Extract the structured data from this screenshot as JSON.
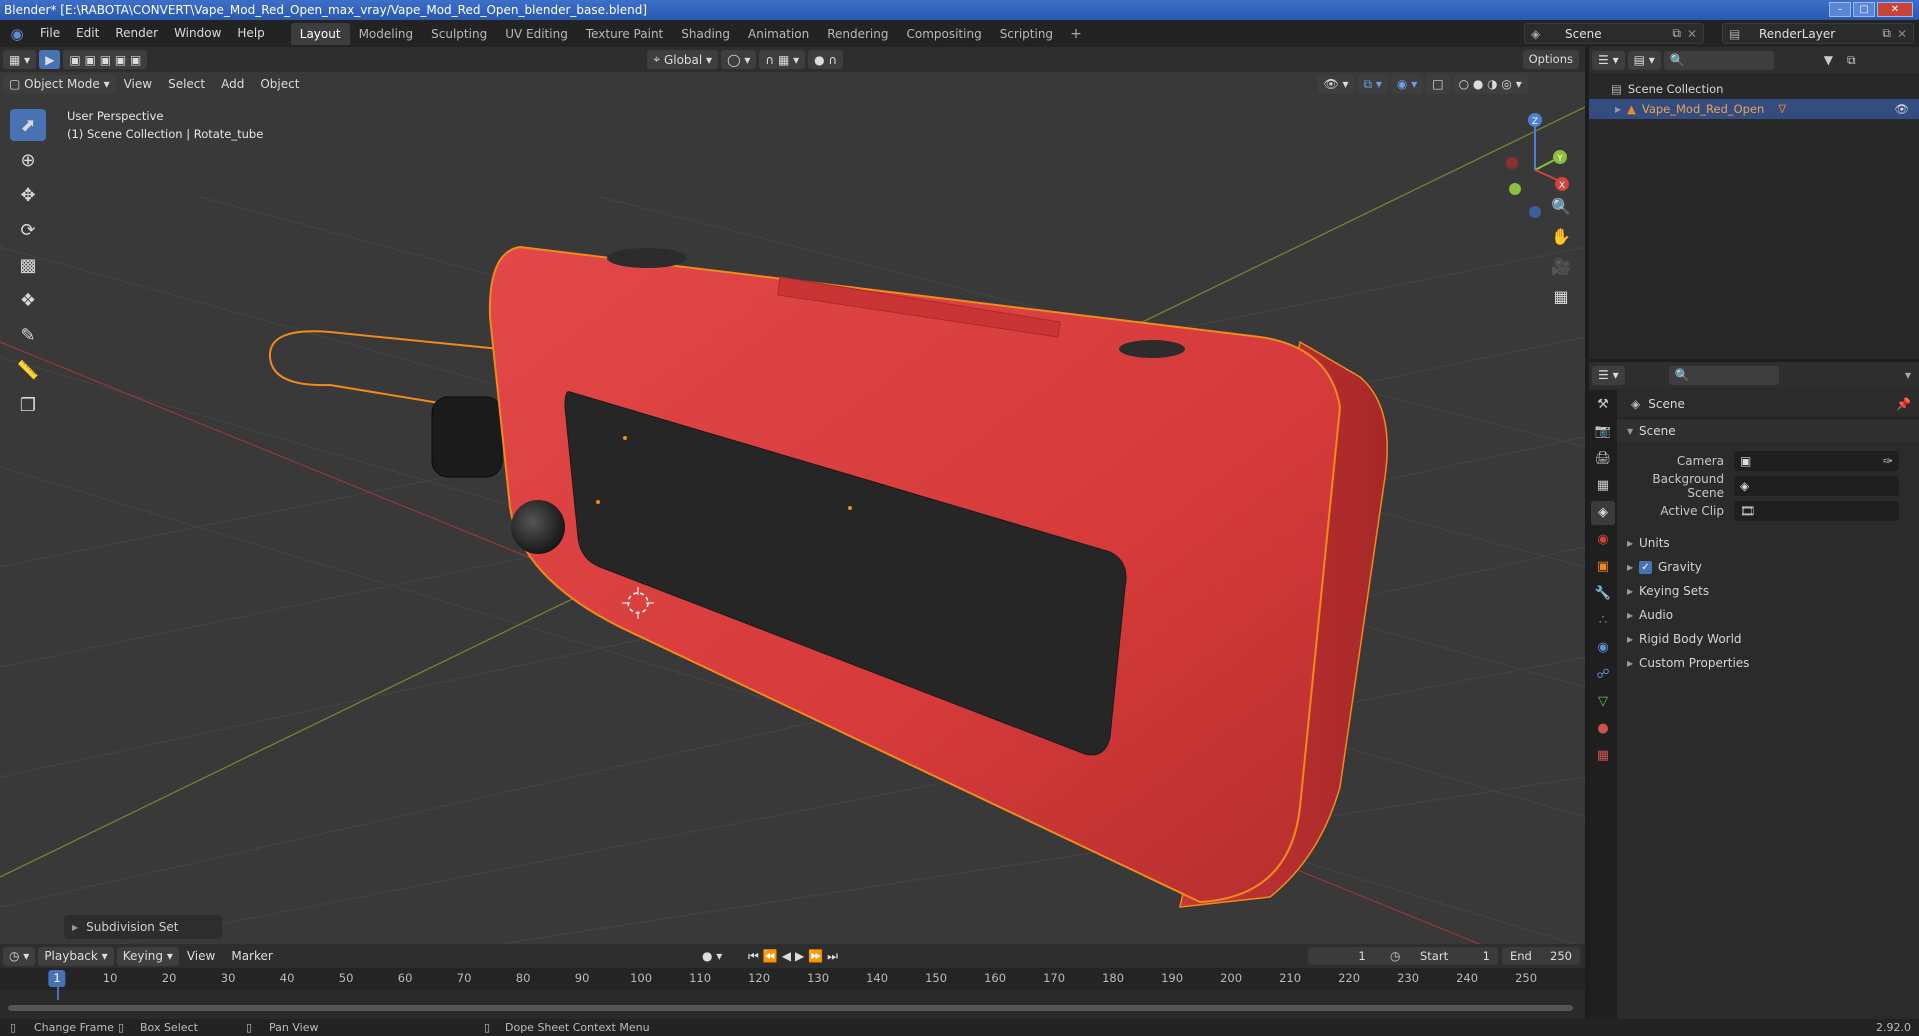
{
  "window": {
    "title": "Blender* [E:\\RABOTA\\CONVERT\\Vape_Mod_Red_Open_max_vray/Vape_Mod_Red_Open_blender_base.blend]"
  },
  "menu": [
    "File",
    "Edit",
    "Render",
    "Window",
    "Help"
  ],
  "workspaces": [
    "Layout",
    "Modeling",
    "Sculpting",
    "UV Editing",
    "Texture Paint",
    "Shading",
    "Animation",
    "Rendering",
    "Compositing",
    "Scripting"
  ],
  "scene_name": "Scene",
  "render_layer": "RenderLayer",
  "viewport": {
    "transform_orientation": "Global",
    "options_label": "Options",
    "mode": "Object Mode",
    "menus": [
      "View",
      "Select",
      "Add",
      "Object"
    ],
    "perspective": "User Perspective",
    "collection_info": "(1) Scene Collection | Rotate_tube",
    "last_operator": "Subdivision Set",
    "gizmo": {
      "x_label": "X",
      "y_label": "Y",
      "z_label": "Z"
    }
  },
  "outliner": {
    "root": "Scene Collection",
    "object": "Vape_Mod_Red_Open"
  },
  "properties": {
    "context": "Scene",
    "section": "Scene",
    "fields": [
      {
        "label": "Camera",
        "value": ""
      },
      {
        "label": "Background Scene",
        "value": ""
      },
      {
        "label": "Active Clip",
        "value": ""
      }
    ],
    "subpanels": [
      "Units",
      "Gravity",
      "Keying Sets",
      "Audio",
      "Rigid Body World",
      "Custom Properties"
    ],
    "gravity_checked": true
  },
  "timeline": {
    "menus": [
      "Playback",
      "Keying",
      "View",
      "Marker"
    ],
    "current_frame": "1",
    "start_label": "Start",
    "start": "1",
    "end_label": "End",
    "end": "250",
    "ticks": [
      "10",
      "20",
      "30",
      "40",
      "50",
      "60",
      "70",
      "80",
      "90",
      "100",
      "110",
      "120",
      "130",
      "140",
      "150",
      "160",
      "170",
      "180",
      "190",
      "200",
      "210",
      "220",
      "230",
      "240",
      "250"
    ]
  },
  "statusbar": {
    "change_frame": "Change Frame",
    "box_select": "Box Select",
    "pan_view": "Pan View",
    "context_menu": "Dope Sheet Context Menu",
    "version": "2.92.0"
  },
  "colors": {
    "accent": "#4772b3",
    "object_red": "#d93a3a",
    "selection_orange": "#f08a1c"
  }
}
